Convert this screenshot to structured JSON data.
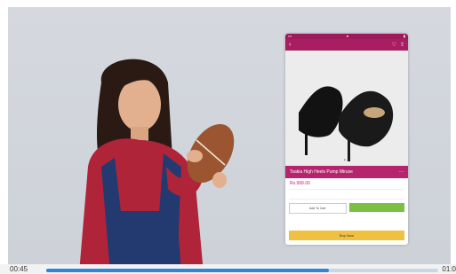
{
  "video": {
    "current_time": "00:45",
    "duration": "01:0",
    "progress": 0.72
  },
  "phone": {
    "product_title": "Tsakia High Heels Pump Miruse",
    "price": "Rs.999.00",
    "left_button_label": "Add To Cart",
    "buy_label": "Buy Now"
  },
  "colors": {
    "brand": "#a81e63",
    "progress": "#2f86d6",
    "green": "#7bc043",
    "buy": "#f0c040"
  }
}
